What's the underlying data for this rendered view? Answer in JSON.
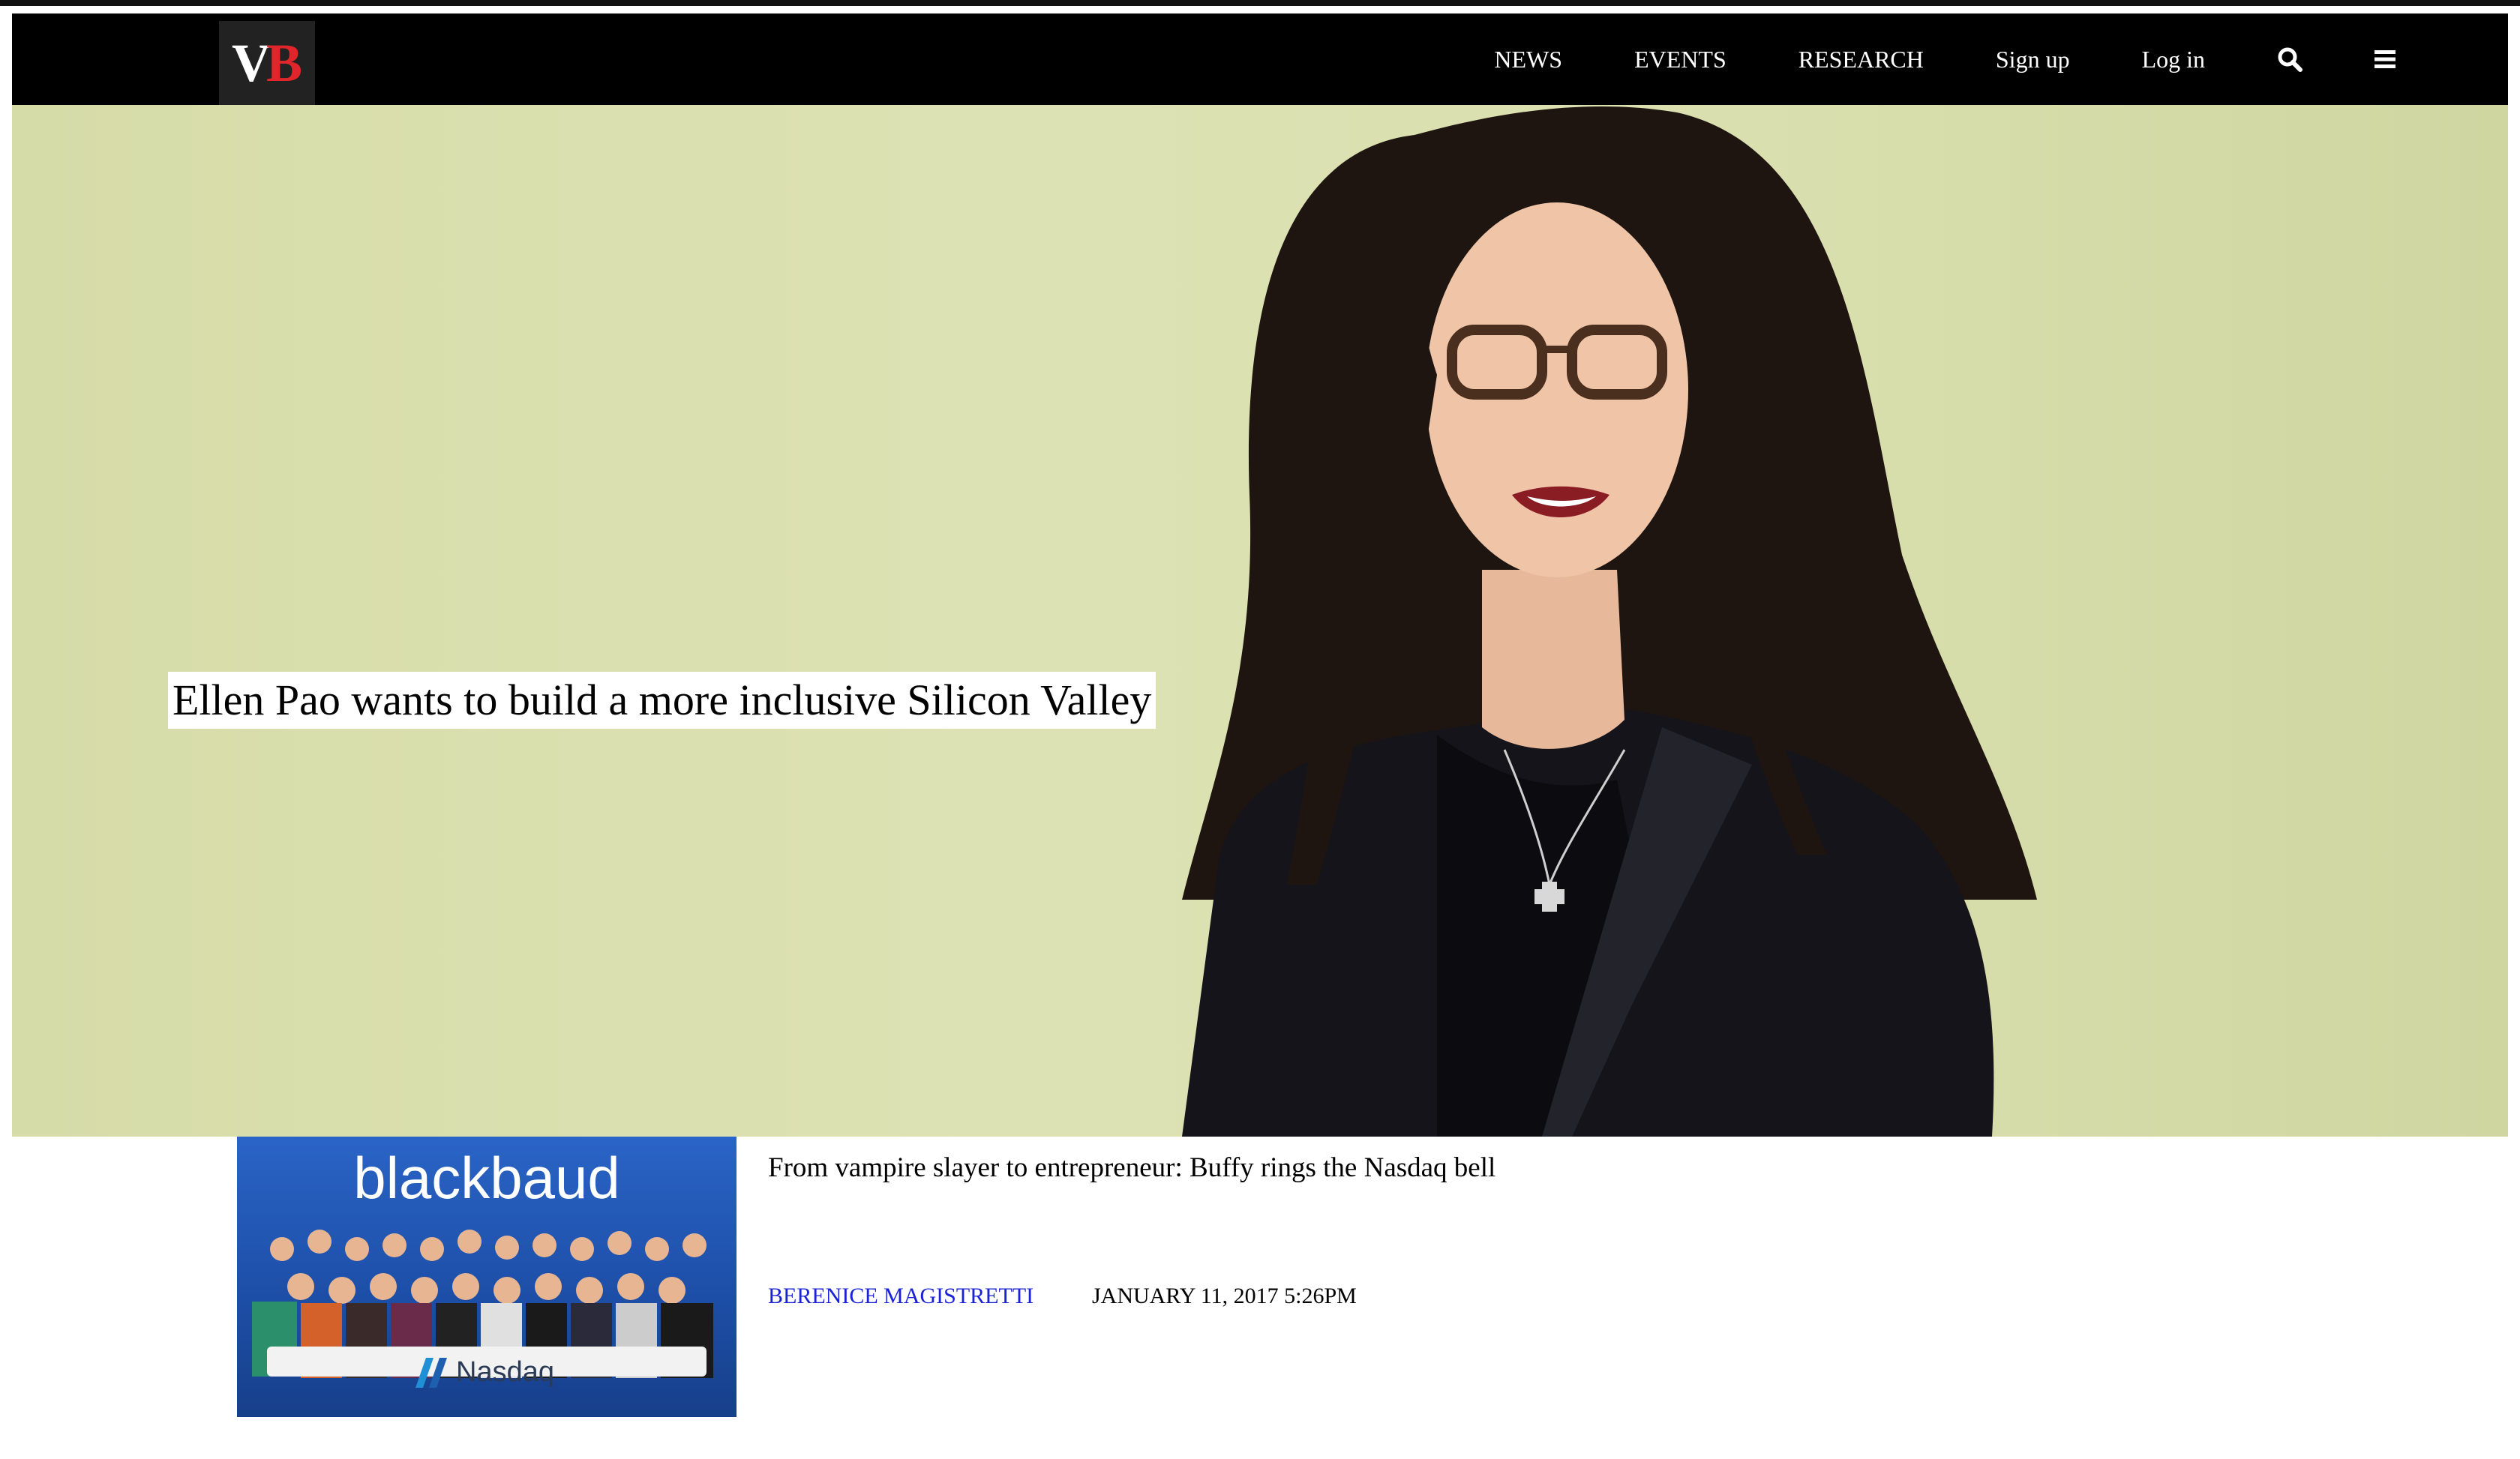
{
  "navbar": {
    "logo": {
      "v": "V",
      "b": "B"
    },
    "items": [
      {
        "label": "NEWS"
      },
      {
        "label": "EVENTS"
      },
      {
        "label": "RESEARCH"
      },
      {
        "label": "Sign up"
      },
      {
        "label": "Log in"
      }
    ],
    "icons": [
      "search-icon",
      "menu-icon"
    ]
  },
  "hero": {
    "title": "Ellen Pao wants to build a more inclusive Silicon Valley",
    "background_color": "#d9deac"
  },
  "story": {
    "thumbnail": {
      "brand": "blackbaud",
      "counter_label": "Nasdaq"
    },
    "title": "From vampire slayer to entrepreneur: Buffy rings the Nasdaq bell",
    "author": "BERENICE MAGISTRETTI",
    "date": "JANUARY 11, 2017 5:26PM",
    "author_color": "#1a22d6"
  }
}
